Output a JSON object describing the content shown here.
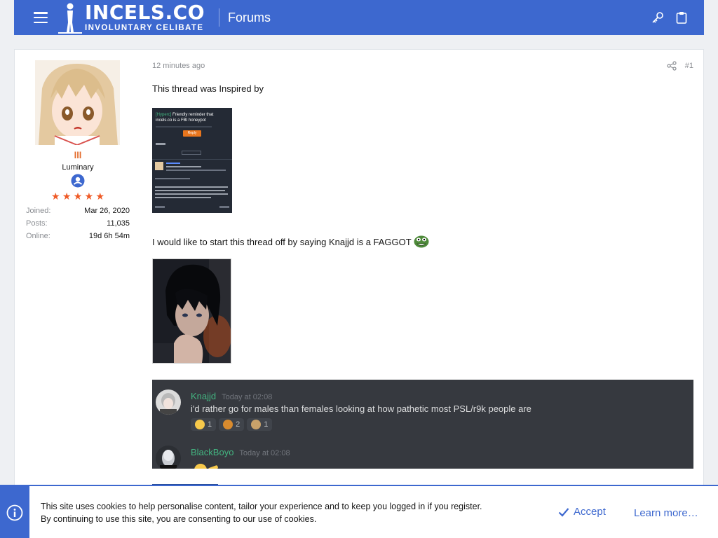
{
  "header": {
    "logo_main": "INCELS.CO",
    "logo_sub": "INVOLUNTARY CELIBATE",
    "nav_label": "Forums",
    "bg_color": "#3d68cf"
  },
  "user": {
    "name": "lll",
    "rank": "Luminary",
    "stars": 5,
    "stats": [
      {
        "label": "Joined:",
        "value": "Mar 26, 2020"
      },
      {
        "label": "Posts:",
        "value": "11,035"
      },
      {
        "label": "Online:",
        "value": "19d 6h 54m"
      }
    ]
  },
  "post": {
    "time": "12 minutes ago",
    "number": "#1",
    "line1": "This thread was Inspired by",
    "line2": "I would like to start this thread off by saying Knajjd is a FAGGOT",
    "embedded_screenshot": {
      "title_tag": "[Hyperc]",
      "title": "Friendly reminder that incels.co is a FBI honeypot",
      "button": "Reply"
    }
  },
  "discord": {
    "messages": [
      {
        "author": "Knajjd",
        "time": "Today at 02:08",
        "text": "i'd rather go for males than females looking at how pathetic most PSL/r9k people are",
        "reactions": [
          {
            "icon": "laughing-emoji",
            "count": "1"
          },
          {
            "icon": "dog-emoji",
            "count": "2"
          },
          {
            "icon": "woman-emoji",
            "count": "1"
          }
        ]
      },
      {
        "author": "BlackBoyo",
        "time": "Today at 02:08",
        "text": ""
      }
    ]
  },
  "cookie": {
    "line1": "This site uses cookies to help personalise content, tailor your experience and to keep you logged in if you register.",
    "line2": "By continuing to use this site, you are consenting to our use of cookies.",
    "accept": "Accept",
    "learn_more": "Learn more…"
  }
}
